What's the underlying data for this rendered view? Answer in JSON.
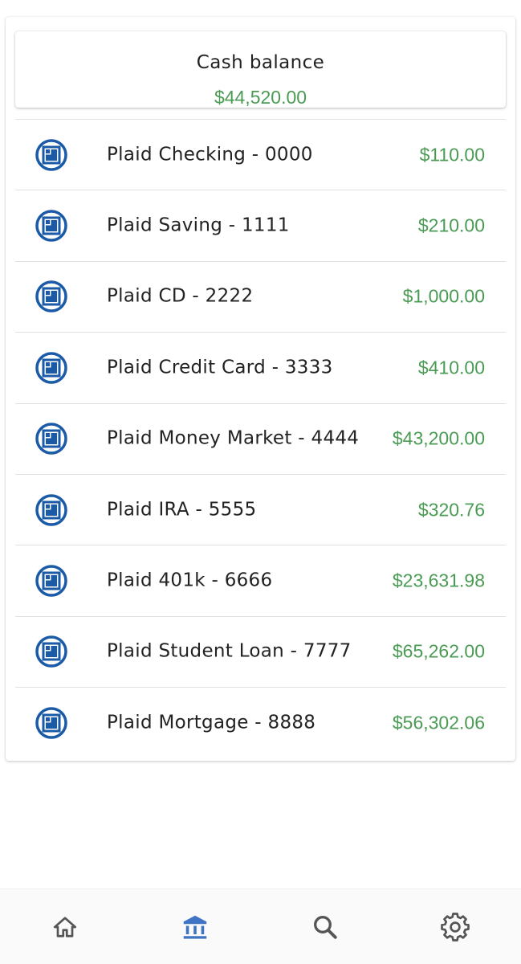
{
  "balance": {
    "title": "Cash balance",
    "amount": "$44,520.00"
  },
  "accounts": [
    {
      "name": "Plaid Checking - 0000",
      "amount": "$110.00",
      "icon": "bank-logo-icon"
    },
    {
      "name": "Plaid Saving - 1111",
      "amount": "$210.00",
      "icon": "bank-logo-icon"
    },
    {
      "name": "Plaid CD - 2222",
      "amount": "$1,000.00",
      "icon": "bank-logo-icon"
    },
    {
      "name": "Plaid Credit Card - 3333",
      "amount": "$410.00",
      "icon": "bank-logo-icon"
    },
    {
      "name": "Plaid Money Market - 4444",
      "amount": "$43,200.00",
      "icon": "bank-logo-icon"
    },
    {
      "name": "Plaid IRA - 5555",
      "amount": "$320.76",
      "icon": "bank-logo-icon"
    },
    {
      "name": "Plaid 401k - 6666",
      "amount": "$23,631.98",
      "icon": "bank-logo-icon"
    },
    {
      "name": "Plaid Student Loan - 7777",
      "amount": "$65,262.00",
      "icon": "bank-logo-icon"
    },
    {
      "name": "Plaid Mortgage - 8888",
      "amount": "$56,302.06",
      "icon": "bank-logo-icon"
    }
  ],
  "nav": {
    "items": [
      {
        "icon": "home-icon",
        "active": false
      },
      {
        "icon": "bank-icon",
        "active": true
      },
      {
        "icon": "search-icon",
        "active": false
      },
      {
        "icon": "gear-icon",
        "active": false
      }
    ]
  },
  "colors": {
    "amount_green": "#4a9b54",
    "logo_blue": "#1a5aa6",
    "nav_active": "#3f74c4",
    "nav_inactive": "#555555"
  }
}
